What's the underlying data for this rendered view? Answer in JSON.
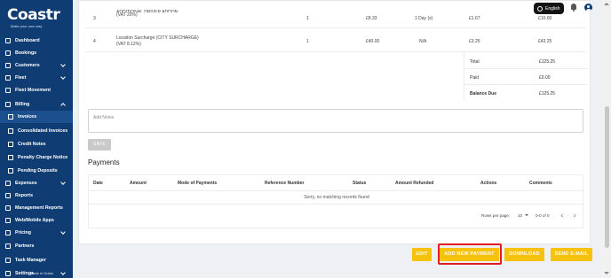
{
  "brand": {
    "name": "Coastr",
    "tagline": "Make your own way"
  },
  "topbar": {
    "language": "English"
  },
  "sidebar": {
    "items": [
      {
        "label": "Dashboard"
      },
      {
        "label": "Bookings"
      },
      {
        "label": "Customers"
      },
      {
        "label": "Fleet"
      },
      {
        "label": "Fleet Movement"
      },
      {
        "label": "Billing"
      },
      {
        "label": "Invoices"
      },
      {
        "label": "Consolidated Invoices"
      },
      {
        "label": "Credit Notes"
      },
      {
        "label": "Penalty Charge Notice"
      },
      {
        "label": "Pending Deposits"
      },
      {
        "label": "Expenses"
      },
      {
        "label": "Reports"
      },
      {
        "label": "Management Reports"
      },
      {
        "label": "Web/Mobile Apps"
      },
      {
        "label": "Pricing"
      },
      {
        "label": "Partners"
      },
      {
        "label": "Task Manager"
      },
      {
        "label": "Settings"
      }
    ],
    "footer_badge": "Made in Dubai"
  },
  "line_items": [
    {
      "no": "3",
      "desc1": "ADDITIONAL DRIVER ADDON",
      "desc2": "(VAT 20%)",
      "qty": "1",
      "price": "£8.33",
      "duration": "1 Day (s)",
      "tax": "£1.67",
      "total": "£10.00"
    },
    {
      "no": "4",
      "desc1": "Location Surcharge (CITY SURCHARGE)",
      "desc2": "(VAT 8.12%)",
      "qty": "1",
      "price": "£40.00",
      "duration": "N/A",
      "tax": "£3.25",
      "total": "£43.25"
    }
  ],
  "totals": [
    {
      "label": "Total",
      "value": "£125.25"
    },
    {
      "label": "Paid",
      "value": "£0.00"
    },
    {
      "label": "Balance Due",
      "value": "£125.25"
    }
  ],
  "notes": {
    "placeholder": "Add Notes"
  },
  "save_label": "SAVE",
  "payments": {
    "title": "Payments",
    "columns": [
      "Date",
      "Amount",
      "Mode of Payments",
      "Reference Number",
      "Status",
      "Amount Refunded",
      "Actions",
      "Comments"
    ],
    "empty_message": "Sorry, no matching records found",
    "rows_per_page_label": "Rows per page:",
    "rows_per_page_value": "10",
    "range": "0-0 of 0"
  },
  "actions": {
    "edit": "EDIT",
    "add_payment": "ADD NEW PAYMENT",
    "download": "DOWNLOAD",
    "send_email": "SEND E-MAIL"
  },
  "colors": {
    "sidebar": "#0f3d73",
    "accent": "#f7c20e",
    "highlight": "#e01e1e"
  }
}
